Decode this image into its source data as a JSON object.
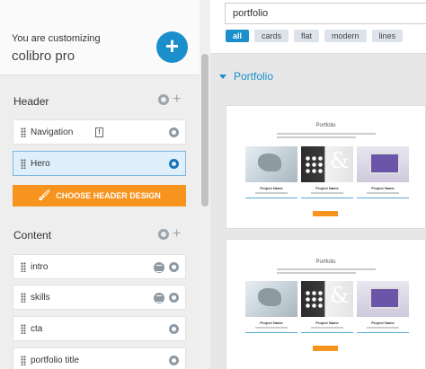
{
  "customizer": {
    "subtitle": "You are customizing",
    "theme_name": "colibro pro",
    "add_symbol": "+"
  },
  "sections": {
    "header": {
      "title": "Header",
      "items": [
        {
          "label": "Navigation"
        },
        {
          "label": "Hero"
        }
      ],
      "choose_button": "CHOOSE HEADER DESIGN"
    },
    "content": {
      "title": "Content",
      "items": [
        {
          "label": "intro"
        },
        {
          "label": "skills"
        },
        {
          "label": "cta"
        },
        {
          "label": "portfolio title"
        }
      ]
    }
  },
  "panel": {
    "search_value": "portfolio",
    "filters": [
      "all",
      "cards",
      "flat",
      "modern",
      "lines"
    ],
    "active_filter": "all",
    "section_label": "Portfolio",
    "previews": [
      {
        "title": "Portfolio",
        "cards": [
          {
            "label": "Project Name"
          },
          {
            "label": "Project Name"
          },
          {
            "label": "Project Name"
          }
        ]
      },
      {
        "title": "Portfolio",
        "cards": [
          {
            "label": "Project Name"
          },
          {
            "label": "Project Name"
          },
          {
            "label": "Project Name"
          }
        ]
      }
    ]
  },
  "colors": {
    "accent_blue": "#1a8fcc",
    "accent_orange": "#f7941d",
    "selected_bg": "#dfeffb"
  }
}
